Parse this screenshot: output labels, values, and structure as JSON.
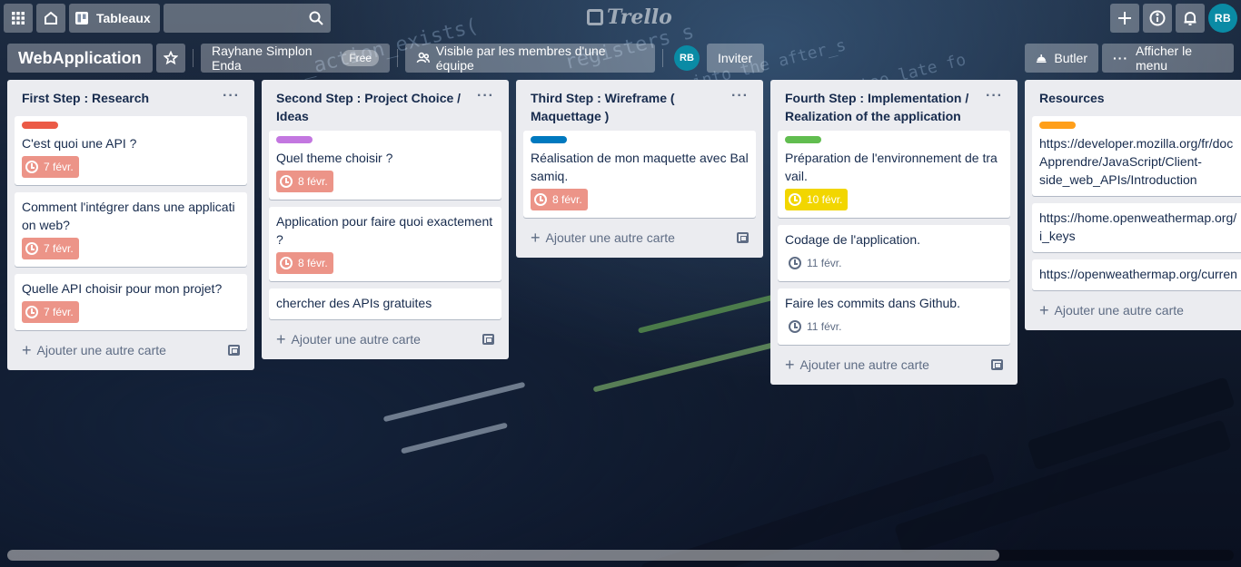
{
  "header": {
    "boards_label": "Tableaux",
    "search_placeholder": "",
    "logo_text": "Trello",
    "avatar_initials": "RB"
  },
  "board": {
    "title": "WebApplication",
    "team_name": "Rayhane Simplon Enda",
    "team_plan": "Free",
    "visibility": "Visible par les membres d'une équipe",
    "member_initials": "RB",
    "invite_label": "Inviter",
    "butler_label": "Butler",
    "menu_label": "Afficher le menu"
  },
  "add_card_label": "Ajouter une autre carte",
  "lists": [
    {
      "title": "First Step : Research",
      "cards": [
        {
          "label_color": "#eb5a46",
          "text": "C'est quoi une API ?",
          "due": "7 févr.",
          "due_state": "overdue"
        },
        {
          "text": "Comment l'intégrer dans une application web?",
          "due": "7 févr.",
          "due_state": "overdue"
        },
        {
          "text": "Quelle API choisir pour mon projet?",
          "due": "7 févr.",
          "due_state": "overdue"
        }
      ]
    },
    {
      "title": "Second Step : Project Choice / Ideas",
      "cards": [
        {
          "label_color": "#c377e0",
          "text": "Quel theme choisir ?",
          "due": "8 févr.",
          "due_state": "overdue"
        },
        {
          "text": "Application pour faire quoi exactement ?",
          "due": "8 févr.",
          "due_state": "overdue"
        },
        {
          "text": "chercher des APIs gratuites"
        }
      ]
    },
    {
      "title": "Third Step : Wireframe ( Maquettage )",
      "cards": [
        {
          "label_color": "#0079bf",
          "text": "Réalisation de mon maquette avec Balsamiq.",
          "due": "8 févr.",
          "due_state": "overdue"
        }
      ]
    },
    {
      "title": "Fourth Step : Implementation / Realization of the application",
      "cards": [
        {
          "label_color": "#61bd4f",
          "text": "Préparation de l'environnement de travail.",
          "due": "10 févr.",
          "due_state": "soon"
        },
        {
          "text": "Codage de l'application.",
          "due": "11 févr.",
          "due_state": "plain"
        },
        {
          "text": "Faire les commits dans Github.",
          "due": "11 févr.",
          "due_state": "plain"
        }
      ]
    },
    {
      "title": "Resources",
      "cards": [
        {
          "label_color": "#ff9f1a",
          "text": "https://developer.mozilla.org/fr/docs/Web/API/Apprendre/JavaScript/Client-side_web_APIs/Introduction",
          "display": "https://developer.mozilla.org/fr/doc Apprendre/JavaScript/Client-side_web_APIs/Introduction"
        },
        {
          "text": "https://home.openweathermap.org/api_keys",
          "display": "https://home.openweathermap.org/ i_keys"
        },
        {
          "text": "https://openweathermap.org/current",
          "display": "https://openweathermap.org/curren"
        }
      ]
    }
  ]
}
